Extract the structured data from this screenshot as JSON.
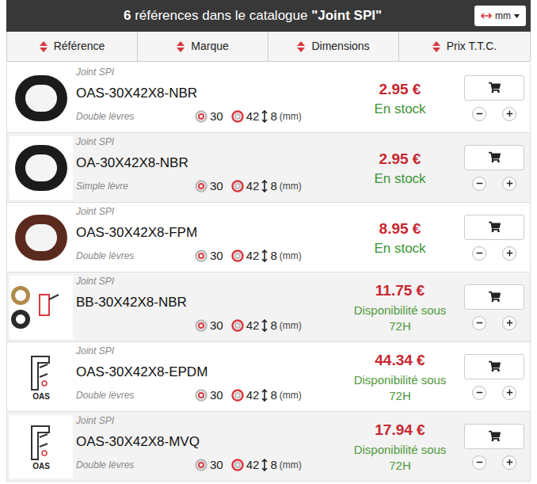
{
  "header": {
    "count": "6",
    "title_before": "références dans le catalogue",
    "catalogue": "\"Joint SPI\"",
    "unit": "mm"
  },
  "columns": [
    {
      "label": "Référence"
    },
    {
      "label": "Marque"
    },
    {
      "label": "Dimensions"
    },
    {
      "label": "Prix T.T.C."
    }
  ],
  "products": [
    {
      "category": "Joint SPI",
      "reference": "OAS-30X42X8-NBR",
      "lips": "Double lèvres",
      "inner": "30",
      "outer": "42",
      "width": "8",
      "unit": "(mm)",
      "price": "2.95 €",
      "availability": "En stock",
      "in_stock": true,
      "image": {
        "kind": "photo",
        "color": "#1b1b1b",
        "caption": ""
      }
    },
    {
      "category": "Joint SPI",
      "reference": "OA-30X42X8-NBR",
      "lips": "Simple lèvre",
      "inner": "30",
      "outer": "42",
      "width": "8",
      "unit": "(mm)",
      "price": "2.95 €",
      "availability": "En stock",
      "in_stock": true,
      "image": {
        "kind": "photo",
        "color": "#1b1b1b",
        "caption": ""
      }
    },
    {
      "category": "Joint SPI",
      "reference": "OAS-30X42X8-FPM",
      "lips": "Double lèvres",
      "inner": "30",
      "outer": "42",
      "width": "8",
      "unit": "(mm)",
      "price": "8.95 €",
      "availability": "En stock",
      "in_stock": true,
      "image": {
        "kind": "photo",
        "color": "#5a2a1e",
        "caption": ""
      }
    },
    {
      "category": "Joint SPI",
      "reference": "BB-30X42X8-NBR",
      "lips": "",
      "inner": "30",
      "outer": "42",
      "width": "8",
      "unit": "(mm)",
      "price": "11.75 €",
      "availability": "Disponibilité sous 72H",
      "in_stock": false,
      "image": {
        "kind": "rings",
        "color": "#2a2a2a",
        "caption": ""
      }
    },
    {
      "category": "Joint SPI",
      "reference": "OAS-30X42X8-EPDM",
      "lips": "Double lèvres",
      "inner": "30",
      "outer": "42",
      "width": "8",
      "unit": "(mm)",
      "price": "44.34 €",
      "availability": "Disponibilité sous 72H",
      "in_stock": false,
      "image": {
        "kind": "diagram",
        "color": "#333333",
        "caption": "OAS"
      }
    },
    {
      "category": "Joint SPI",
      "reference": "OAS-30X42X8-MVQ",
      "lips": "Double lèvres",
      "inner": "30",
      "outer": "42",
      "width": "8",
      "unit": "(mm)",
      "price": "17.94 €",
      "availability": "Disponibilité sous 72H",
      "in_stock": false,
      "image": {
        "kind": "diagram",
        "color": "#333333",
        "caption": "OAS"
      }
    }
  ]
}
